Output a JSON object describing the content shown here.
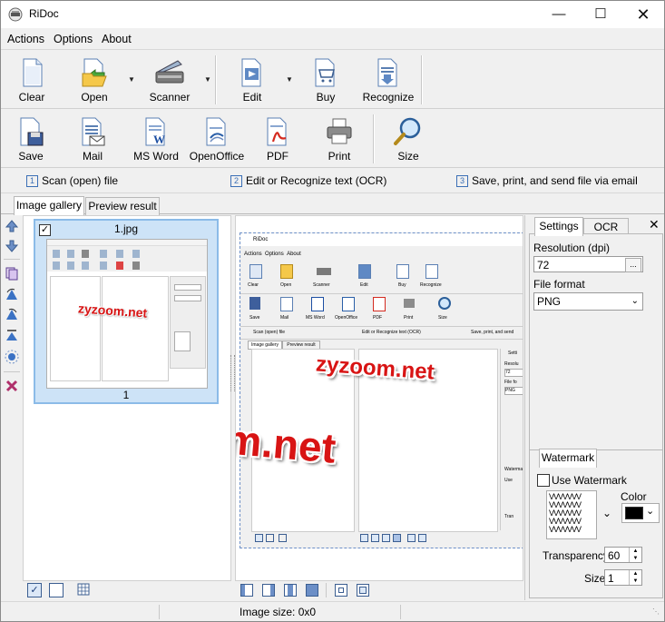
{
  "window": {
    "title": "RiDoc",
    "controls": [
      "minimize-icon",
      "maximize-icon",
      "close-icon"
    ]
  },
  "menu": [
    "Actions",
    "Options",
    "About"
  ],
  "toolbar_top": [
    {
      "label": "Clear",
      "icon": "blank-page-icon"
    },
    {
      "label": "Open",
      "icon": "open-folder-icon"
    },
    {
      "label": "Scanner",
      "icon": "scanner-icon"
    },
    {
      "label": "Edit",
      "icon": "edit-doc-icon"
    },
    {
      "label": "Buy",
      "icon": "cart-doc-icon"
    },
    {
      "label": "Recognize",
      "icon": "recognize-doc-icon"
    }
  ],
  "toolbar_bottom": [
    {
      "label": "Save",
      "icon": "save-doc-icon"
    },
    {
      "label": "Mail",
      "icon": "mail-doc-icon"
    },
    {
      "label": "MS Word",
      "icon": "word-doc-icon"
    },
    {
      "label": "OpenOffice",
      "icon": "openoffice-doc-icon"
    },
    {
      "label": "PDF",
      "icon": "pdf-doc-icon"
    },
    {
      "label": "Print",
      "icon": "printer-icon"
    },
    {
      "label": "Size",
      "icon": "magnifier-icon"
    }
  ],
  "steps": [
    {
      "num": "1",
      "text": "Scan (open) file"
    },
    {
      "num": "2",
      "text": "Edit or Recognize text (OCR)"
    },
    {
      "num": "3",
      "text": "Save, print, and send file via email"
    }
  ],
  "tabs": {
    "gallery": "Image gallery",
    "preview": "Preview result"
  },
  "gallery": {
    "item_name": "1.jpg",
    "item_number": "1",
    "checked": true,
    "watermark": "zyzoom.net"
  },
  "preview": {
    "watermark_small": "zyzoom.net",
    "watermark_large": "zyzoom.net",
    "mini": {
      "title": "RiDoc",
      "menu": [
        "Actions",
        "Options",
        "About"
      ],
      "tb1": [
        "Clear",
        "Open",
        "Scanner",
        "Edit",
        "Buy",
        "Recognize"
      ],
      "tb2": [
        "Save",
        "Mail",
        "MS Word",
        "OpenOffice",
        "PDF",
        "Print",
        "Size"
      ],
      "steps": [
        "Scan (open) file",
        "Edit or Recognize text (OCR)",
        "Save, print, and send"
      ],
      "tabs": [
        "Image gallery",
        "Preview result"
      ],
      "panel_tab": "Setti",
      "res_label": "Resolu",
      "res_value": "72",
      "ff_label": "File fo",
      "ff_value": "PNG",
      "wm_tab": "Waterma",
      "use_label": "Use",
      "trans_label": "Tran"
    }
  },
  "settings": {
    "tabs": [
      "Settings",
      "OCR"
    ],
    "resolution_label": "Resolution (dpi)",
    "resolution_value": "72",
    "dots": "...",
    "file_format_label": "File format",
    "file_format_value": "PNG",
    "watermark_tab": "Watermark",
    "use_watermark_label": "Use Watermark",
    "use_watermark_checked": false,
    "color_label": "Color",
    "color_value": "#000000",
    "transparency_label": "Transparency",
    "transparency_value": "60",
    "size_label": "Size",
    "size_value": "1",
    "pattern_text": "VVVVVVV"
  },
  "status": {
    "image_size": "Image size: 0x0"
  }
}
